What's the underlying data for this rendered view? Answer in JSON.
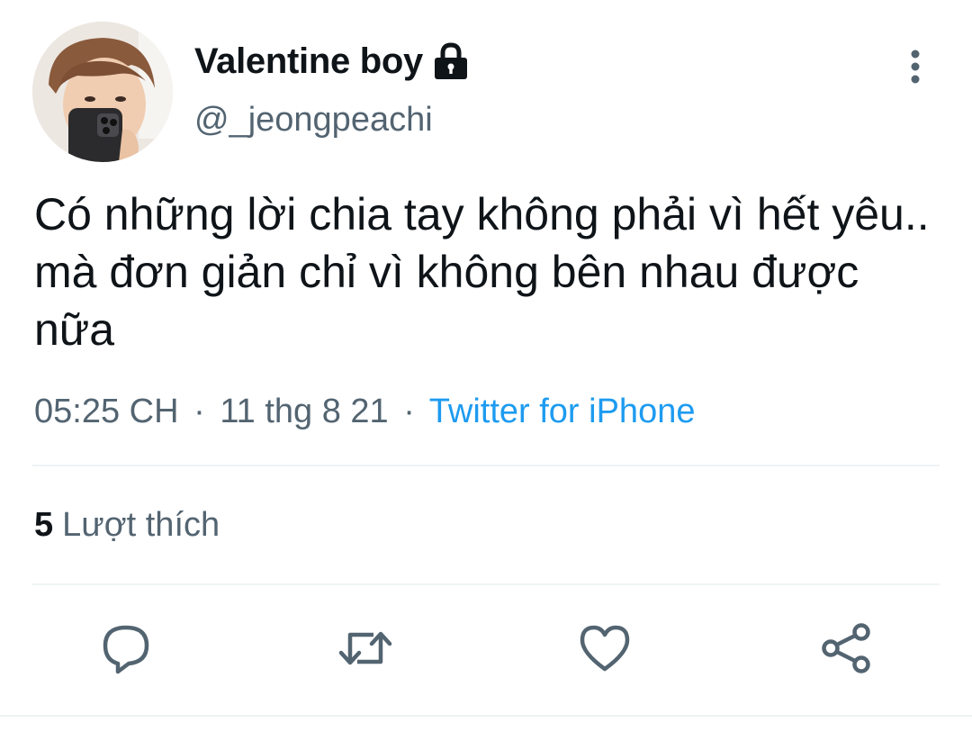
{
  "tweet": {
    "author": {
      "display_name": "Valentine boy",
      "handle": "@_jeongpeachi",
      "protected": true
    },
    "text": "Có những lời chia tay không phải vì hết yêu.. mà đơn giản chỉ vì không bên nhau được nữa",
    "time": "05:25 CH",
    "date": "11 thg 8 21",
    "separator": "·",
    "source": "Twitter for iPhone",
    "likes_count": "5",
    "likes_label": "Lượt thích"
  },
  "icons": {
    "lock": "lock-icon",
    "more": "more-vertical-icon",
    "reply": "reply-icon",
    "retweet": "retweet-icon",
    "like": "heart-icon",
    "share": "share-icon"
  },
  "colors": {
    "text_primary": "#0f1419",
    "text_secondary": "#536471",
    "link": "#1d9bf0",
    "divider": "#eff3f4"
  }
}
